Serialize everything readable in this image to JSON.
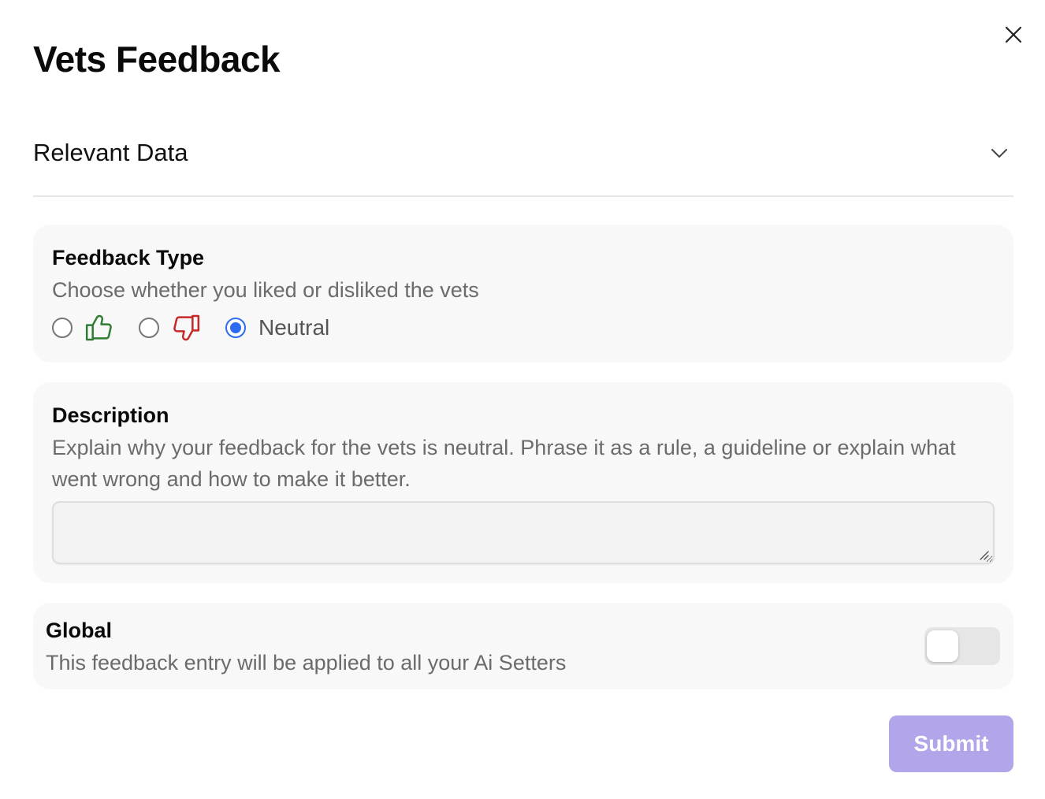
{
  "dialog": {
    "title": "Vets Feedback"
  },
  "accordion": {
    "label": "Relevant Data"
  },
  "feedback_type": {
    "title": "Feedback Type",
    "subtitle": "Choose whether you liked or disliked the vets",
    "options": [
      {
        "value": "like",
        "icon": "thumbs-up-icon",
        "color": "#2e7d32",
        "checked": false
      },
      {
        "value": "dislike",
        "icon": "thumbs-down-icon",
        "color": "#c62828",
        "checked": false
      },
      {
        "value": "neutral",
        "label": "Neutral",
        "checked": true
      }
    ]
  },
  "description": {
    "title": "Description",
    "subtitle": "Explain why your feedback for the vets is neutral. Phrase it as a rule, a guideline or explain what went wrong and how to make it better.",
    "value": "",
    "placeholder": ""
  },
  "global": {
    "title": "Global",
    "subtitle": "This feedback entry will be applied to all your Ai Setters",
    "enabled": false
  },
  "submit": {
    "label": "Submit",
    "disabled": true
  },
  "colors": {
    "accent": "#2d6cf0",
    "submit_bg": "#b2a5ea",
    "card_bg": "#f8f8f8"
  }
}
